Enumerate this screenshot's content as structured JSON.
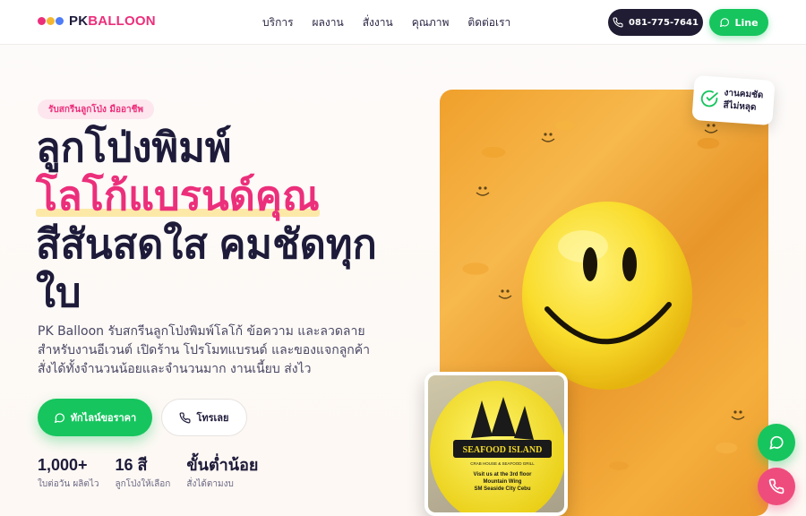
{
  "brand": {
    "name_part1": "PK",
    "name_part2": "BALLOON",
    "dot_colors": [
      "#ec2f7b",
      "#f5b731",
      "#4f7cf7"
    ]
  },
  "nav": {
    "items": [
      {
        "label": "บริการ"
      },
      {
        "label": "ผลงาน"
      },
      {
        "label": "สั่งงาน"
      },
      {
        "label": "คุณภาพ"
      },
      {
        "label": "ติดต่อเรา"
      }
    ]
  },
  "header_actions": {
    "phone_label": "081-775-7641",
    "line_label": "Line"
  },
  "hero": {
    "badge": "รับสกรีนลูกโป่ง มืออาชีพ",
    "title_line1": "ลูกโป่งพิมพ์",
    "title_accent": "โลโก้แบรนด์คุณ",
    "title_line3": "สีสันสดใส คมชัดทุกใบ",
    "description": "PK Balloon รับสกรีนลูกโป่งพิมพ์โลโก้ ข้อความ และลวดลาย สำหรับงานอีเวนต์ เปิดร้าน โปรโมทแบรนด์ และของแจกลูกค้า สั่งได้ทั้งจำนวนน้อยและจำนวนมาก งานเนี้ยบ ส่งไว",
    "cta_quote": "ทักไลน์ขอราคา",
    "cta_call": "โทรเลย"
  },
  "stats": [
    {
      "num": "1,000+",
      "label": "ใบต่อวัน ผลิตไว"
    },
    {
      "num": "16 สี",
      "label": "ลูกโป่งให้เลือก"
    },
    {
      "num": "ขั้นต่ำน้อย",
      "label": "สั่งได้ตามงบ"
    }
  ],
  "photo_badge": {
    "line1": "งานคมชัด",
    "line2": "สีไม่หลุด"
  },
  "inset_print": {
    "brand": "SEAFOOD ISLAND",
    "sub": "CRAB HOUSE & SEAFOOD GRILL",
    "line1": "Visit us at the 3rd floor",
    "line2": "Mountain Wing",
    "line3": "SM Seaside City Cebu"
  },
  "colors": {
    "accent_pink": "#ec2f7b",
    "line_green": "#16c55e",
    "dark": "#1f1c33"
  }
}
